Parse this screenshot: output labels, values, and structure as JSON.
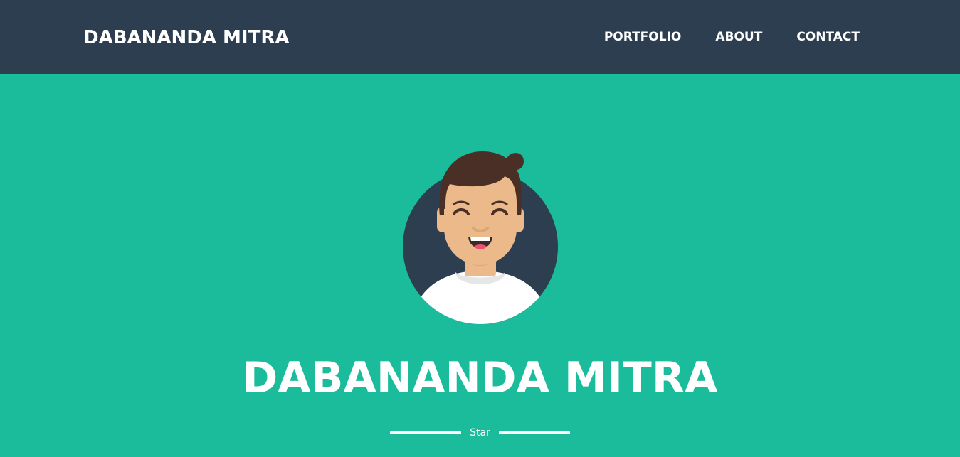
{
  "navbar": {
    "brand": "DABANANDA MITRA",
    "links": [
      {
        "label": "PORTFOLIO"
      },
      {
        "label": "ABOUT"
      },
      {
        "label": "CONTACT"
      }
    ]
  },
  "masthead": {
    "title": "DABANANDA MITRA",
    "subtitle": "Star",
    "avatar_icon": "avatar-icon"
  },
  "colors": {
    "navbar_bg": "#2c3e50",
    "masthead_bg": "#1abc9c",
    "text": "#ffffff"
  }
}
